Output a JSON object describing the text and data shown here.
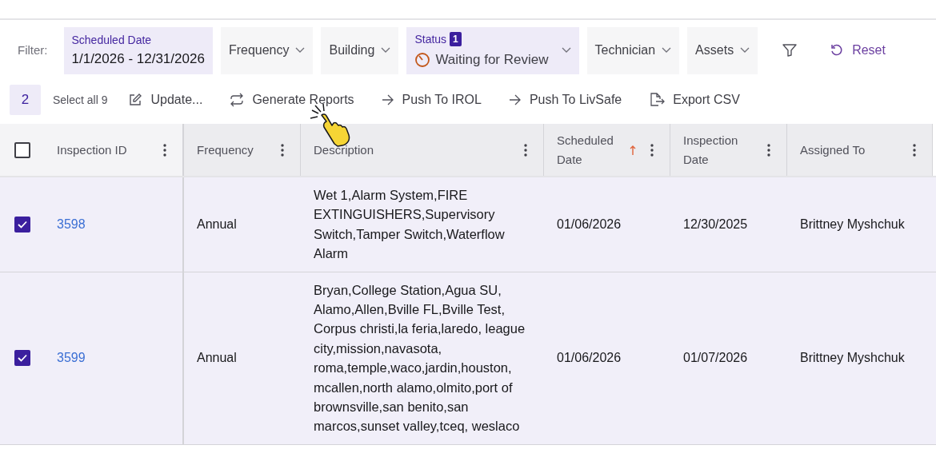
{
  "filter_bar": {
    "label": "Filter:",
    "filters": [
      {
        "kind": "range",
        "label": "Scheduled Date",
        "value": "1/1/2026 - 12/31/2026"
      },
      {
        "kind": "dropdown",
        "label": "Frequency"
      },
      {
        "kind": "dropdown",
        "label": "Building"
      },
      {
        "kind": "status",
        "label": "Status",
        "count": "1",
        "value": "Waiting for Review"
      },
      {
        "kind": "dropdown",
        "label": "Technician"
      },
      {
        "kind": "dropdown",
        "label": "Assets"
      }
    ],
    "reset": "Reset"
  },
  "selection_bar": {
    "count": "2",
    "select_all": "Select all 9",
    "actions": [
      {
        "kind": "edit",
        "label": "Update..."
      },
      {
        "kind": "refresh",
        "label": "Generate Reports"
      },
      {
        "kind": "arrow",
        "label": "Push To IROL"
      },
      {
        "kind": "arrow",
        "label": "Push To LivSafe"
      },
      {
        "kind": "export",
        "label": "Export CSV"
      }
    ]
  },
  "table": {
    "all_checked": false,
    "columns": [
      {
        "label": "Inspection ID",
        "sorted": false
      },
      {
        "label": "Frequency",
        "sorted": false
      },
      {
        "label": "Description",
        "sorted": false
      },
      {
        "label": "Scheduled Date",
        "sorted": true
      },
      {
        "label": "Inspection Date",
        "sorted": false
      },
      {
        "label": "Assigned To",
        "sorted": false
      }
    ],
    "rows": [
      {
        "checked": true,
        "id": "3598",
        "frequency": "Annual",
        "description": "Wet 1,Alarm System,FIRE EXTINGUISHERS,Supervisory Switch,Tamper Switch,Waterflow Alarm",
        "scheduled": "01/06/2026",
        "inspected": "12/30/2025",
        "assigned": "Brittney Myshchuk"
      },
      {
        "checked": true,
        "id": "3599",
        "frequency": "Annual",
        "description": "Bryan,College Station,Agua SU, Alamo,Allen,Bville FL,Bville Test, Corpus christi,la feria,laredo, league city,mission,navasota, roma,temple,waco,jardin,houston, mcallen,north alamo,olmito,port of brownsville,san benito,san marcos,sunset valley,tceq, weslaco",
        "scheduled": "01/06/2026",
        "inspected": "01/07/2026",
        "assigned": "Brittney Myshchuk"
      }
    ]
  }
}
